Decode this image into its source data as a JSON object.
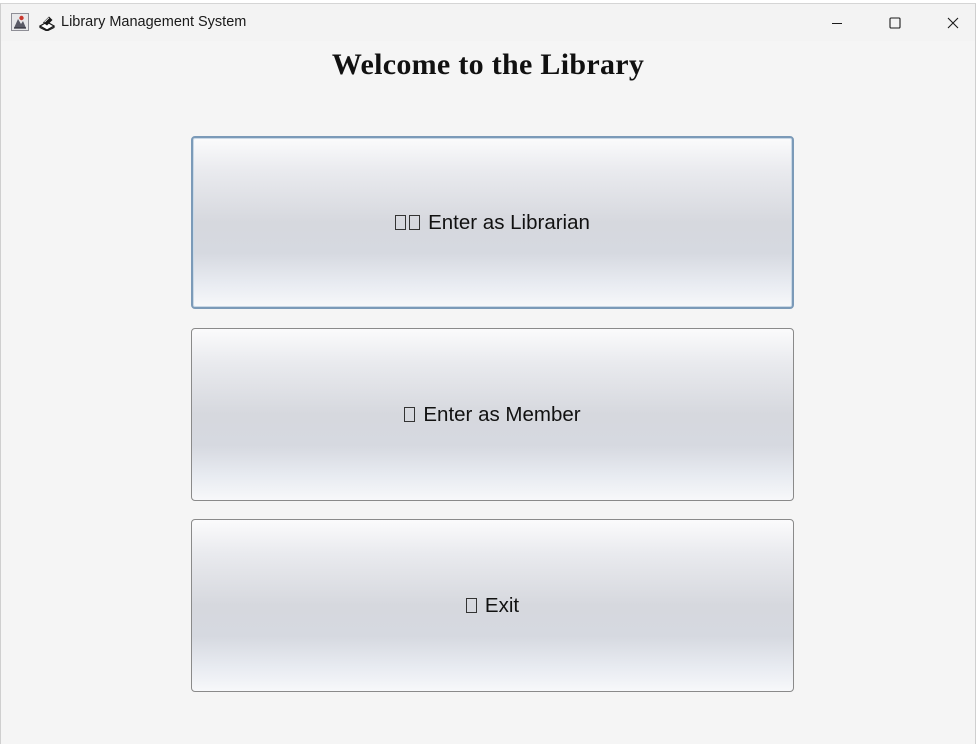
{
  "window": {
    "title": "Library Management System"
  },
  "heading": {
    "text": "Welcome to the Library"
  },
  "buttons": [
    {
      "label": "Enter as Librarian",
      "icon": "missing-glyph-icon",
      "glyph_count": 2,
      "focused": true
    },
    {
      "label": "Enter as Member",
      "icon": "missing-glyph-icon",
      "glyph_count": 1,
      "focused": false
    },
    {
      "label": "Exit",
      "icon": "missing-glyph-icon",
      "glyph_count": 1,
      "focused": false
    }
  ],
  "window_controls": [
    "minimize",
    "maximize",
    "close"
  ],
  "colors": {
    "window_background": "#f5f5f5",
    "focus_border": "#7b9ab8",
    "button_border": "#8a8a8a"
  }
}
